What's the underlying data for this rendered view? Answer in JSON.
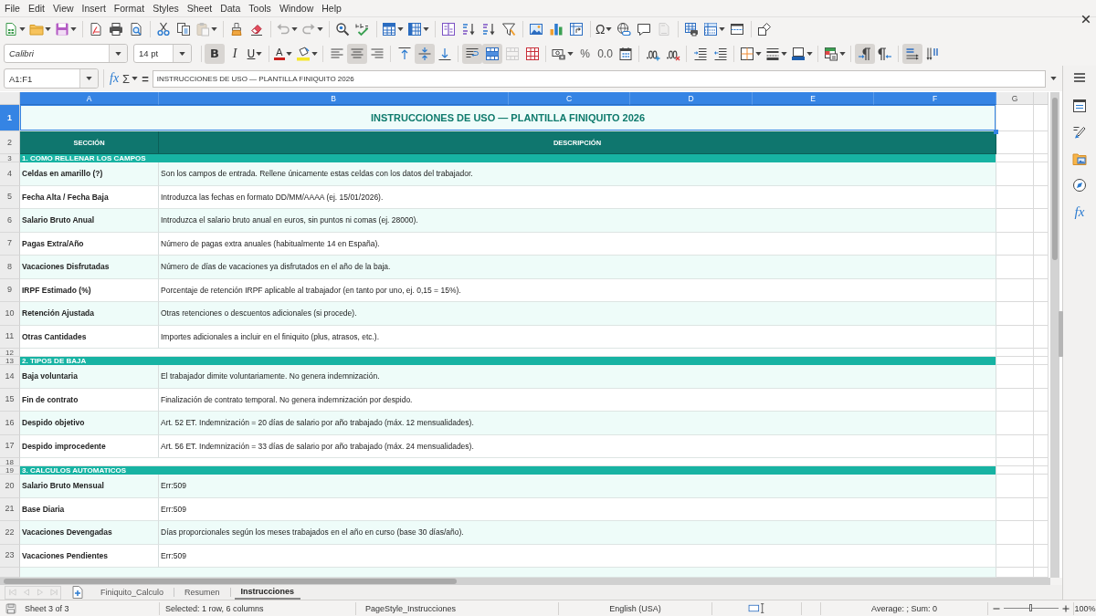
{
  "menu_bar": {
    "items": [
      "File",
      "Edit",
      "View",
      "Insert",
      "Format",
      "Styles",
      "Sheet",
      "Data",
      "Tools",
      "Window",
      "Help"
    ]
  },
  "standard_toolbar": {
    "paste_disabled": true,
    "undo_disabled": true,
    "redo_disabled": true,
    "special_character": "Ω",
    "header_footer_disabled": true
  },
  "formatting_toolbar": {
    "font_name": "Calibri",
    "font_size": "14 pt",
    "bold": {
      "label": "B",
      "pressed": true
    },
    "italic": {
      "label": "I",
      "pressed": false
    },
    "underline": {
      "label": "U",
      "pressed": false
    },
    "font_color": "A",
    "align_left": false,
    "align_center": true,
    "align_right": false,
    "align_top": false,
    "align_middle": true,
    "align_bottom": false,
    "wrap_text": true,
    "merge_and_center": true,
    "merge_cells_disabled": true,
    "percent": "%",
    "number_format": "0.0",
    "left_to_right": true,
    "right_to_left": false,
    "text_horizontal": true,
    "text_vertical": false
  },
  "formula_bar": {
    "name_box": "A1:F1",
    "function_wizard": "fx",
    "sum": "Σ",
    "formula": "=",
    "content": "INSTRUCCIONES DE USO — PLANTILLA FINIQUITO 2026"
  },
  "sheet": {
    "columns": [
      {
        "label": "A",
        "selected": true
      },
      {
        "label": "B",
        "selected": true
      },
      {
        "label": "C",
        "selected": true
      },
      {
        "label": "D",
        "selected": true
      },
      {
        "label": "E",
        "selected": true
      },
      {
        "label": "F",
        "selected": true
      },
      {
        "label": "G",
        "selected": false
      }
    ],
    "rows": [
      {
        "number": "1",
        "kind": "title",
        "selected": true,
        "cells": [
          "INSTRUCCIONES DE USO — PLANTILLA FINIQUITO 2026"
        ]
      },
      {
        "number": "2",
        "kind": "header",
        "selected": false,
        "cells": [
          "SECCIÓN",
          "DESCRIPCIÓN"
        ]
      },
      {
        "number": "3",
        "kind": "section",
        "selected": false,
        "cells": [
          "1. COMO RELLENAR LOS CAMPOS"
        ]
      },
      {
        "number": "4",
        "kind": "data",
        "selected": false,
        "shaded": true,
        "cells": [
          "Celdas en amarillo (?)",
          "Son los campos de entrada. Rellene únicamente estas celdas con los datos del trabajador."
        ]
      },
      {
        "number": "5",
        "kind": "data",
        "selected": false,
        "shaded": false,
        "cells": [
          "Fecha Alta / Fecha Baja",
          "Introduzca las fechas en formato DD/MM/AAAA (ej. 15/01/2026)."
        ]
      },
      {
        "number": "6",
        "kind": "data",
        "selected": false,
        "shaded": true,
        "cells": [
          "Salario Bruto Anual",
          "Introduzca el salario bruto anual en euros, sin puntos ni comas (ej. 28000)."
        ]
      },
      {
        "number": "7",
        "kind": "data",
        "selected": false,
        "shaded": false,
        "cells": [
          "Pagas Extra/Año",
          "Número de pagas extra anuales (habitualmente 14 en España)."
        ]
      },
      {
        "number": "8",
        "kind": "data",
        "selected": false,
        "shaded": true,
        "cells": [
          "Vacaciones Disfrutadas",
          "Número de días de vacaciones ya disfrutados en el año de la baja."
        ]
      },
      {
        "number": "9",
        "kind": "data",
        "selected": false,
        "shaded": false,
        "cells": [
          "IRPF Estimado (%)",
          "Porcentaje de retención IRPF aplicable al trabajador (en tanto por uno, ej. 0,15 = 15%)."
        ]
      },
      {
        "number": "10",
        "kind": "data",
        "selected": false,
        "shaded": true,
        "cells": [
          "Retención Ajustada",
          "Otras retenciones o descuentos adicionales (si procede)."
        ]
      },
      {
        "number": "11",
        "kind": "data",
        "selected": false,
        "shaded": false,
        "cells": [
          "Otras Cantidades",
          "Importes adicionales a incluir en el finiquito (plus, atrasos, etc.)."
        ]
      },
      {
        "number": "12",
        "kind": "blank",
        "selected": false
      },
      {
        "number": "13",
        "kind": "section",
        "selected": false,
        "cells": [
          "2. TIPOS DE BAJA"
        ]
      },
      {
        "number": "14",
        "kind": "data",
        "selected": false,
        "shaded": true,
        "cells": [
          "Baja voluntaria",
          "El trabajador dimite voluntariamente. No genera indemnización."
        ]
      },
      {
        "number": "15",
        "kind": "data",
        "selected": false,
        "shaded": false,
        "cells": [
          "Fin de contrato",
          "Finalización de contrato temporal. No genera indemnización por despido."
        ]
      },
      {
        "number": "16",
        "kind": "data",
        "selected": false,
        "shaded": true,
        "cells": [
          "Despido objetivo",
          "Art. 52 ET. Indemnización = 20 días de salario por año trabajado (máx. 12 mensualidades)."
        ]
      },
      {
        "number": "17",
        "kind": "data",
        "selected": false,
        "shaded": false,
        "cells": [
          "Despido improcedente",
          "Art. 56 ET. Indemnización = 33 días de salario por año trabajado (máx. 24 mensualidades)."
        ]
      },
      {
        "number": "18",
        "kind": "blank",
        "selected": false
      },
      {
        "number": "19",
        "kind": "section",
        "selected": false,
        "cells": [
          "3. CALCULOS AUTOMATICOS"
        ]
      },
      {
        "number": "20",
        "kind": "data",
        "selected": false,
        "shaded": true,
        "cells": [
          "Salario Bruto Mensual",
          "Err:509"
        ]
      },
      {
        "number": "21",
        "kind": "data",
        "selected": false,
        "shaded": false,
        "cells": [
          "Base Diaria",
          "Err:509"
        ]
      },
      {
        "number": "22",
        "kind": "data",
        "selected": false,
        "shaded": true,
        "cells": [
          "Vacaciones Devengadas",
          "Días proporcionales según los meses trabajados en el año en curso (base 30 días/año)."
        ]
      },
      {
        "number": "23",
        "kind": "data",
        "selected": false,
        "shaded": false,
        "cells": [
          "Vacaciones Pendientes",
          "Err:509"
        ]
      }
    ]
  },
  "sheet_tabs": {
    "navigation_disabled": true,
    "tabs": [
      {
        "label": "Finiquito_Calculo",
        "selected": false
      },
      {
        "label": "Resumen",
        "selected": false
      },
      {
        "label": "Instrucciones",
        "selected": true
      }
    ]
  },
  "sidebar": {
    "functions": "fx"
  },
  "status_bar": {
    "sheet": "Sheet 3 of 3",
    "selection": "Selected: 1 row, 6 columns",
    "page_style": "PageStyle_Instrucciones",
    "language": "English (USA)",
    "summary": "Average: ; Sum: 0",
    "zoom_slider": {
      "level": 0.5
    },
    "zoom": "100%"
  }
}
